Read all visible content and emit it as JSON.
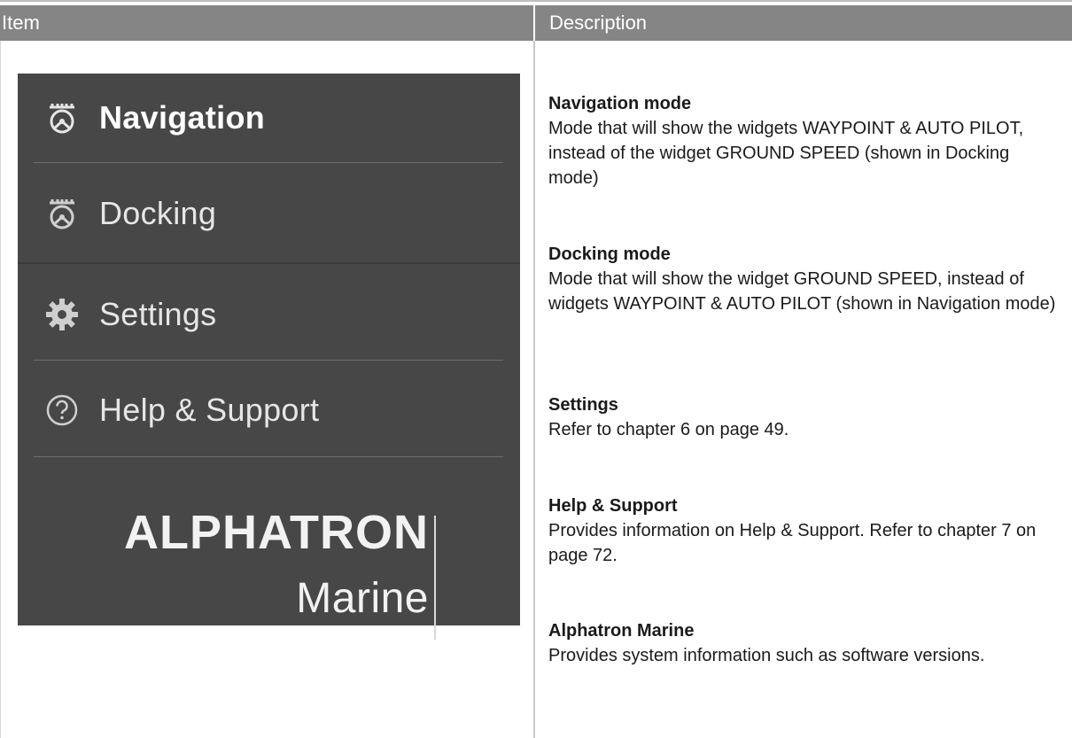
{
  "table": {
    "header_item": "Item",
    "header_description": "Description"
  },
  "menu": {
    "items": [
      {
        "label": "Navigation",
        "icon": "steering-wheel-icon",
        "active": true
      },
      {
        "label": "Docking",
        "icon": "steering-wheel-icon",
        "active": false
      },
      {
        "label": "Settings",
        "icon": "gear-icon",
        "active": false
      },
      {
        "label": "Help & Support",
        "icon": "question-circle-icon",
        "active": false
      }
    ],
    "brand_line1": "ALPHATRON",
    "brand_line2": "Marine",
    "colors": {
      "panel": "#474747",
      "header": "#858585"
    }
  },
  "descriptions": [
    {
      "title": "Navigation mode",
      "text": "Mode that will show the widgets WAYPOINT & AUTO PILOT, instead of the widget GROUND SPEED (shown in Docking mode)"
    },
    {
      "title": "Docking mode",
      "text": "Mode that will show the widget GROUND SPEED, instead of widgets WAYPOINT & AUTO PILOT (shown in Navigation mode)"
    },
    {
      "title": "Settings",
      "text": "Refer to chapter 6 on page 49."
    },
    {
      "title": "Help & Support",
      "text": "Provides information on Help & Support. Refer to chapter 7 on page 72."
    },
    {
      "title": "Alphatron Marine",
      "text": "Provides system information such as software versions."
    }
  ]
}
